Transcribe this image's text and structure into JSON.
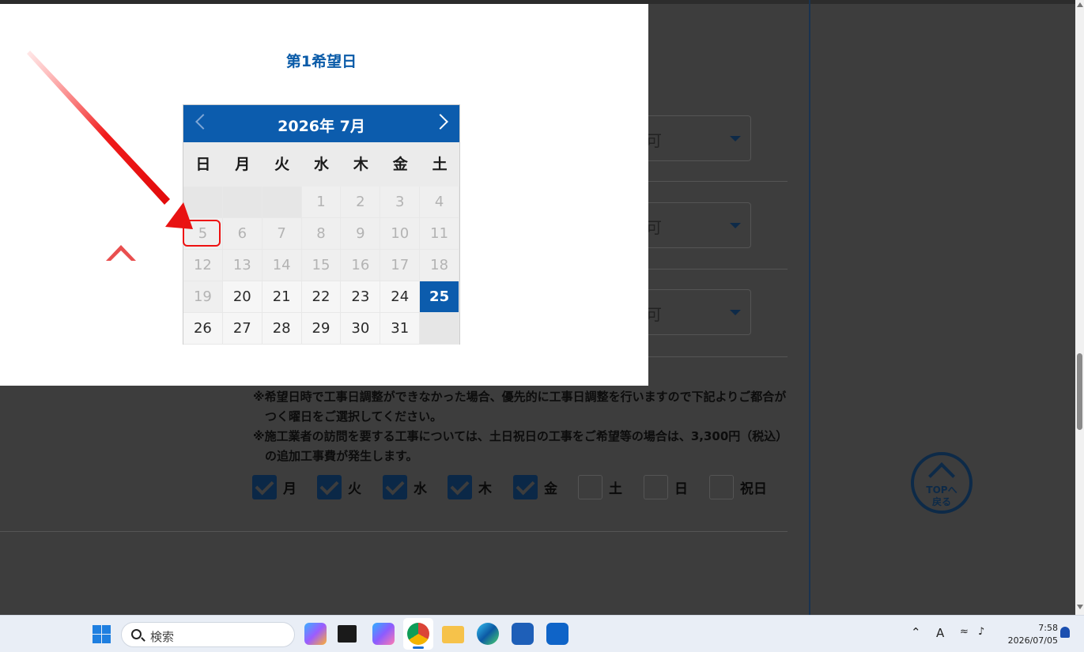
{
  "modal": {
    "title": "第1希望日"
  },
  "calendar": {
    "month_title": "2026年 7月",
    "prev_label": "previous-month",
    "next_label": "next-month",
    "weekdays": [
      "日",
      "月",
      "火",
      "水",
      "木",
      "金",
      "土"
    ],
    "weeks": [
      [
        "",
        "",
        "",
        "1",
        "2",
        "3",
        "4"
      ],
      [
        "5",
        "6",
        "7",
        "8",
        "9",
        "10",
        "11"
      ],
      [
        "12",
        "13",
        "14",
        "15",
        "16",
        "17",
        "18"
      ],
      [
        "19",
        "20",
        "21",
        "22",
        "23",
        "24",
        "25"
      ],
      [
        "26",
        "27",
        "28",
        "29",
        "30",
        "31",
        ""
      ]
    ],
    "first_enabled_day": 20,
    "selected_day": 25,
    "highlighted_day": 5
  },
  "background": {
    "select_values": [
      "可",
      "可",
      "可"
    ],
    "notes": [
      "※希望日時で工事日調整ができなかった場合、優先的に工事日調整を行いますので下記よりご都合がつく曜日をご選択してください。",
      "※施工業者の訪問を要する工事については、土日祝日の工事をご希望等の場合は、3,300円（税込）の追加工事費が発生します。"
    ],
    "day_checkboxes": [
      {
        "label": "月",
        "checked": true
      },
      {
        "label": "火",
        "checked": true
      },
      {
        "label": "水",
        "checked": true
      },
      {
        "label": "木",
        "checked": true
      },
      {
        "label": "金",
        "checked": true
      },
      {
        "label": "土",
        "checked": false
      },
      {
        "label": "日",
        "checked": false
      },
      {
        "label": "祝日",
        "checked": false
      }
    ],
    "top_button": {
      "line1": "TOPへ",
      "line2": "戻る"
    }
  },
  "taskbar": {
    "search_placeholder": "検索",
    "tray_ime": "A",
    "time": "7:58",
    "date": "2026/07/05"
  },
  "colors": {
    "accent": "#0c5cad",
    "annotation": "#e11111",
    "checkbox": "#0b2847"
  }
}
